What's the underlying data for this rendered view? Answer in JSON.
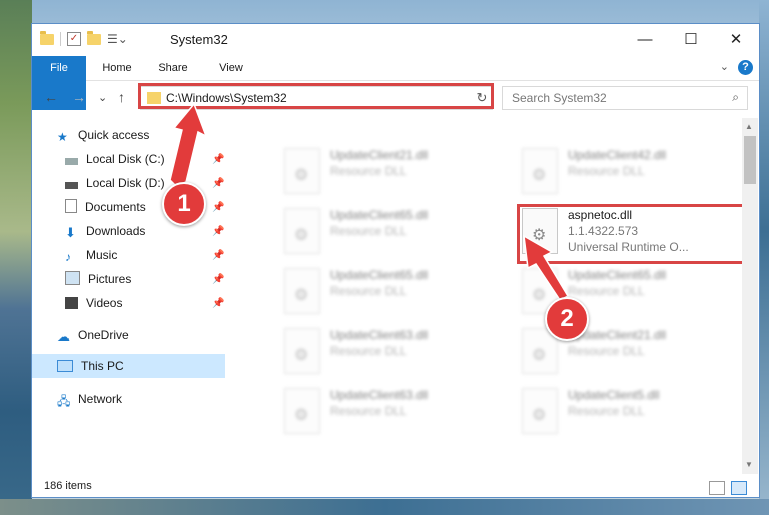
{
  "window": {
    "title": "System32",
    "minimize": "—",
    "maximize": "☐",
    "close": "✕"
  },
  "ribbon": {
    "tabs": [
      "File",
      "Home",
      "Share",
      "View"
    ],
    "help": "?",
    "expand": "⌄"
  },
  "nav": {
    "back": "←",
    "forward": "→",
    "recent": "⌄",
    "up": "↑",
    "address": "C:\\Windows\\System32",
    "address_drop": "⌄",
    "refresh": "↻",
    "search_placeholder": "Search System32",
    "search_icon": "⌕"
  },
  "sidebar": {
    "items": [
      {
        "label": "Quick access",
        "icon": "star-icon"
      },
      {
        "label": "Local Disk (C:)",
        "icon": "drive-icon"
      },
      {
        "label": "Local Disk (D:)",
        "icon": "drive-icon"
      },
      {
        "label": "Documents",
        "icon": "document-icon"
      },
      {
        "label": "Downloads",
        "icon": "download-icon"
      },
      {
        "label": "Music",
        "icon": "music-icon"
      },
      {
        "label": "Pictures",
        "icon": "picture-icon"
      },
      {
        "label": "Videos",
        "icon": "video-icon"
      },
      {
        "label": "OneDrive",
        "icon": "cloud-icon"
      },
      {
        "label": "This PC",
        "icon": "computer-icon"
      },
      {
        "label": "Network",
        "icon": "network-icon"
      }
    ],
    "pin_glyph": "📌"
  },
  "files": [
    {
      "name": "UpdateClient21.dll",
      "desc": "Resource DLL"
    },
    {
      "name": "UpdateClient42.dll",
      "desc": "Resource DLL"
    },
    {
      "name": "UpdateClient65.dll",
      "desc": "Resource DLL"
    },
    {
      "name": "aspnetoc.dll",
      "version": "1.1.4322.573",
      "desc": "Universal Runtime O..."
    },
    {
      "name": "UpdateClient65.dll",
      "desc": "Resource DLL"
    },
    {
      "name": "UpdateClient65.dll",
      "desc": "Resource DLL"
    },
    {
      "name": "UpdateClient63.dll",
      "desc": "Resource DLL"
    },
    {
      "name": "UpdateClient21.dll",
      "desc": "Resource DLL"
    },
    {
      "name": "UpdateClient63.dll",
      "desc": "Resource DLL"
    },
    {
      "name": "UpdateClient5.dll",
      "desc": "Resource DLL"
    }
  ],
  "status": {
    "count": "186 items"
  },
  "callouts": [
    "1",
    "2"
  ],
  "colors": {
    "accent": "#1979ca",
    "highlight": "#d84545",
    "selection": "#cce8ff"
  }
}
